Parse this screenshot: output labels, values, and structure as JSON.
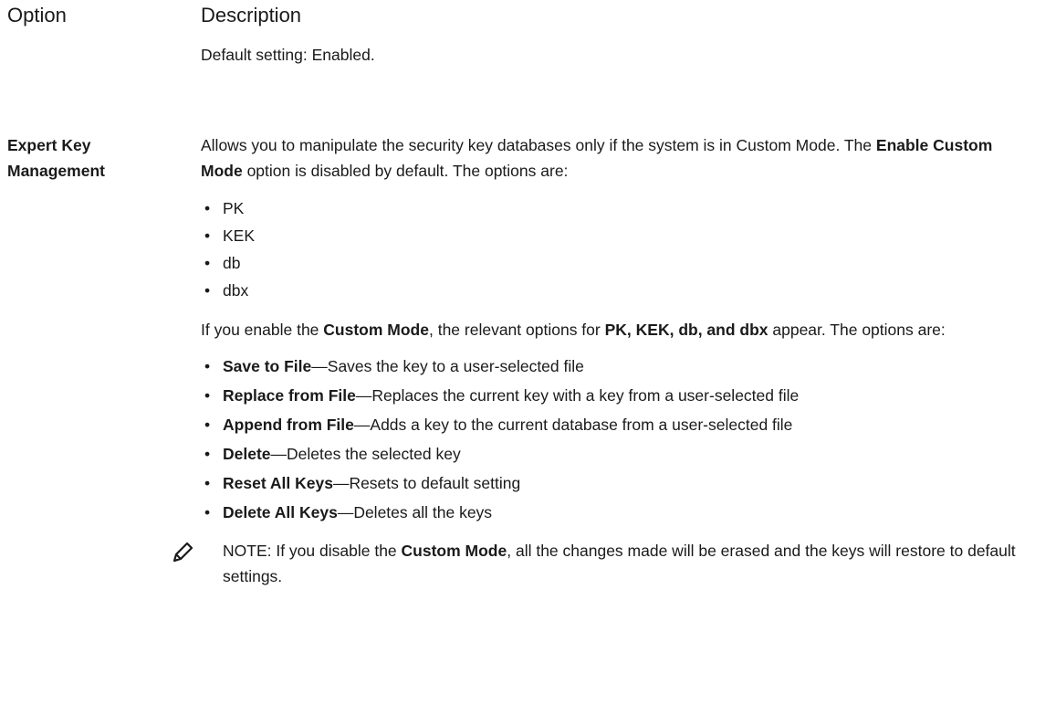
{
  "header": {
    "option": "Option",
    "description": "Description"
  },
  "default_setting": "Default setting: Enabled.",
  "option": {
    "name_line1": "Expert Key",
    "name_line2": "Management",
    "intro_1": "Allows you to manipulate the security key databases only if the system is in Custom Mode. The ",
    "intro_bold": "Enable Custom Mode",
    "intro_2": " option is disabled by default. The options are:",
    "simple_options": [
      "PK",
      "KEK",
      "db",
      "dbx"
    ],
    "para2_1": "If you enable the ",
    "para2_bold1": "Custom Mode",
    "para2_2": ", the relevant options for ",
    "para2_bold2": "PK, KEK, db, and dbx",
    "para2_3": " appear. The options are:",
    "actions": [
      {
        "label": "Save to File",
        "desc": "—Saves the key to a user-selected file"
      },
      {
        "label": "Replace from File",
        "desc": "—Replaces the current key with a key from a user-selected file"
      },
      {
        "label": "Append from File",
        "desc": "—Adds a key to the current database from a user-selected file"
      },
      {
        "label": "Delete",
        "desc": "—Deletes the selected key"
      },
      {
        "label": "Reset All Keys",
        "desc": "—Resets to default setting"
      },
      {
        "label": "Delete All Keys",
        "desc": "—Deletes all the keys"
      }
    ],
    "note": {
      "icon": "pencil-note-icon",
      "label": "NOTE:",
      "text_1": " If you disable the ",
      "bold": "Custom Mode",
      "text_2": ", all the changes made will be erased and the keys will restore to default settings."
    }
  }
}
